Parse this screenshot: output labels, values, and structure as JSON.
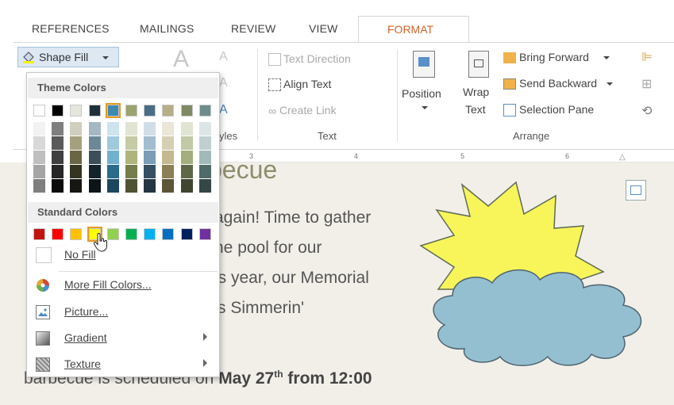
{
  "tabs": [
    "REFERENCES",
    "MAILINGS",
    "REVIEW",
    "VIEW",
    "FORMAT"
  ],
  "ribbon": {
    "shape_fill": "Shape Fill",
    "text_group": {
      "text_direction": "Text Direction",
      "align_text": "Align Text",
      "create_link": "Create Link",
      "label": "Text"
    },
    "styles_label": "yles",
    "arrange_group": {
      "position": "Position",
      "wrap": "Wrap",
      "wrap_text": "Text",
      "bring_forward": "Bring Forward",
      "send_backward": "Send Backward",
      "selection_pane": "Selection Pane",
      "label": "Arrange"
    }
  },
  "ruler": [
    "3",
    "4",
    "5",
    "6"
  ],
  "document": {
    "heading": "becue",
    "lines": [
      "again! Time to gather",
      "he pool for our",
      "is year, our Memorial",
      "'s Simmerin'"
    ],
    "last_line_plain": "barbecue is scheduled on",
    "last_line_bold": "May 27",
    "last_line_sup": "th",
    "last_line_bold2": "from 12:00"
  },
  "dropdown": {
    "theme_colors_title": "Theme Colors",
    "standard_colors_title": "Standard Colors",
    "no_fill": "No Fill",
    "more_fill_colors": "More Fill Colors...",
    "picture": "Picture...",
    "gradient": "Gradient",
    "texture": "Texture",
    "theme_top": [
      "#ffffff",
      "#000000",
      "#e7e6dc",
      "#1f3039",
      "#3d8ab0",
      "#9ca36e",
      "#4a6d85",
      "#b5ae86",
      "#7f8a62",
      "#6e8c8c"
    ],
    "theme_shades": [
      [
        "#f2f2f2",
        "#7f7f7f",
        "#d0cebc",
        "#a4b7c2",
        "#cde3ee",
        "#e1e4d2",
        "#d1dee7",
        "#eae6d8",
        "#e0e4d3",
        "#dde6e6"
      ],
      [
        "#d8d8d8",
        "#595959",
        "#a5a17e",
        "#6c8797",
        "#a0c9de",
        "#c6cba6",
        "#a2bdcf",
        "#d6cfb3",
        "#c1c9a7",
        "#c0d0d0"
      ],
      [
        "#bfbfbf",
        "#3f3f3f",
        "#6a6545",
        "#3b4f5a",
        "#72b1cd",
        "#aeb47c",
        "#7a9db9",
        "#c3b88f",
        "#a3ad7d",
        "#a2b9b9"
      ],
      [
        "#a5a5a5",
        "#262626",
        "#353322",
        "#15232b",
        "#2c6b8a",
        "#767d4d",
        "#374f62",
        "#8a7f55",
        "#5f6749",
        "#506969"
      ],
      [
        "#7f7f7f",
        "#0c0c0c",
        "#161612",
        "#0c1417",
        "#1d475c",
        "#4f5333",
        "#253541",
        "#5c5538",
        "#3f4531",
        "#354646"
      ]
    ],
    "standard": [
      "#c0140c",
      "#ff0000",
      "#ffc000",
      "#ffff00",
      "#92d050",
      "#00b050",
      "#00b0f0",
      "#0070c0",
      "#002060",
      "#7030a0"
    ]
  },
  "colors": {
    "accent_tab": "#d0642a",
    "sun_fill": "#f7f55a",
    "cloud_fill": "#94bfd0"
  }
}
